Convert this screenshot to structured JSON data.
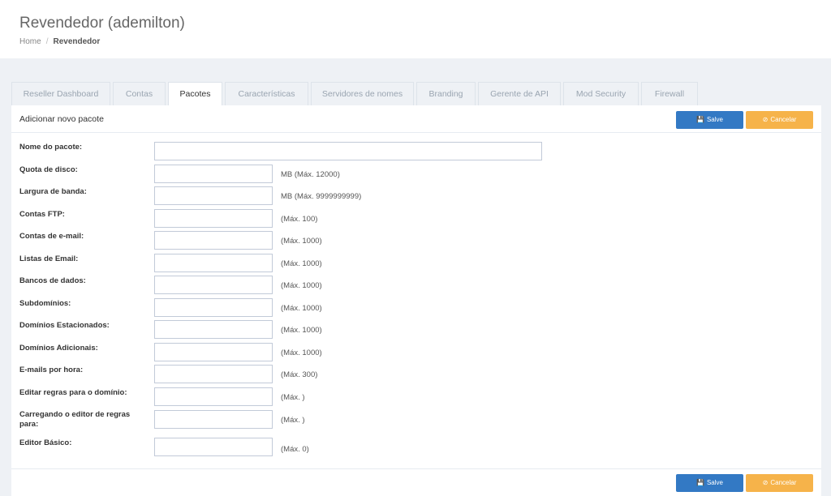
{
  "header": {
    "title": "Revendedor (ademilton)",
    "breadcrumb": {
      "home": "Home",
      "separator": "/",
      "current": "Revendedor"
    }
  },
  "tabs": [
    {
      "label": "Reseller Dashboard"
    },
    {
      "label": "Contas"
    },
    {
      "label": "Pacotes",
      "active": true
    },
    {
      "label": "Características"
    },
    {
      "label": "Servidores de nomes"
    },
    {
      "label": "Branding"
    },
    {
      "label": "Gerente de API"
    },
    {
      "label": "Mod Security"
    },
    {
      "label": "Firewall"
    }
  ],
  "panel": {
    "title": "Adicionar novo pacote",
    "save_label": "Salve",
    "save_icon": "floppy-disk-icon",
    "cancel_label": "Cancelar",
    "cancel_icon": "ban-icon"
  },
  "form": {
    "fields": [
      {
        "label": "Nome do pacote:",
        "value": "",
        "hint": ""
      },
      {
        "label": "Quota de disco:",
        "value": "",
        "hint": "MB  (Máx. 12000)"
      },
      {
        "label": "Largura de banda:",
        "value": "",
        "hint": "MB  (Máx. 9999999999)"
      },
      {
        "label": "Contas FTP:",
        "value": "",
        "hint": "(Máx. 100)"
      },
      {
        "label": "Contas de e-mail:",
        "value": "",
        "hint": "(Máx. 1000)"
      },
      {
        "label": "Listas de Email:",
        "value": "",
        "hint": "(Máx. 1000)"
      },
      {
        "label": "Bancos de dados:",
        "value": "",
        "hint": "(Máx. 1000)"
      },
      {
        "label": "Subdomínios:",
        "value": "",
        "hint": "(Máx. 1000)"
      },
      {
        "label": "Domínios Estacionados:",
        "value": "",
        "hint": "(Máx. 1000)"
      },
      {
        "label": "Domínios Adicionais:",
        "value": "",
        "hint": "(Máx. 1000)"
      },
      {
        "label": "E-mails por hora:",
        "value": "",
        "hint": "(Máx. 300)"
      },
      {
        "label": "Editar regras para o domínio:",
        "value": "",
        "hint": "(Máx. )"
      },
      {
        "label": "Carregando o editor de regras para:",
        "value": "",
        "hint": "(Máx. )"
      },
      {
        "label": "Editor Básico:",
        "value": "",
        "hint": "(Máx. 0)"
      }
    ]
  },
  "colors": {
    "primary": "#3379c4",
    "warning": "#f6b34a",
    "background": "#eef1f5"
  }
}
